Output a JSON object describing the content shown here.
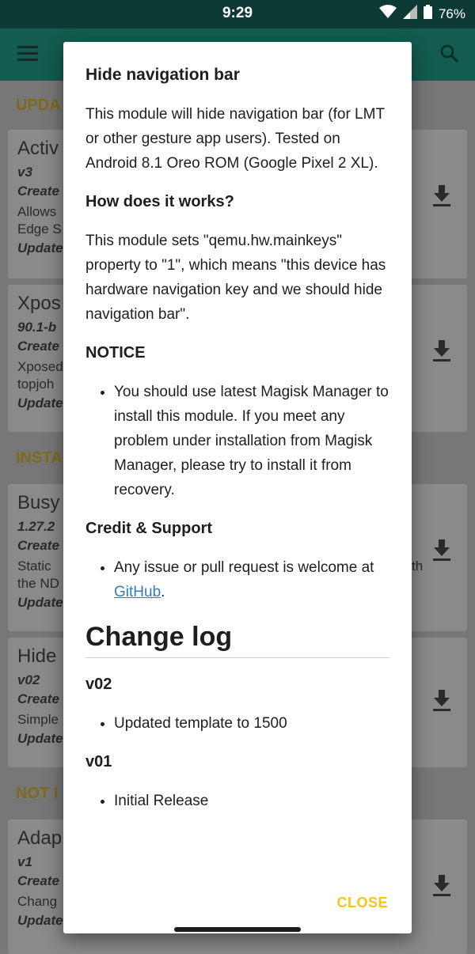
{
  "statusbar": {
    "time": "9:29",
    "battery": "76%"
  },
  "background": {
    "sections": [
      "UPDA",
      "INSTA",
      "NOT I"
    ],
    "cards": [
      {
        "name": "Activ",
        "version": "v3",
        "line1": "Create",
        "line2": "Allows",
        "line3": "Edge S",
        "line4": "Update"
      },
      {
        "name": "Xpos",
        "version": "90.1-b",
        "line1": "Create",
        "line2": "Xposed",
        "line3": "topjoh",
        "line4": "Update"
      },
      {
        "name": "Busy",
        "version": "1.27.2",
        "line1": "Create",
        "line2": "Static",
        "line3": "the ND",
        "line4": "Update",
        "extra": "th"
      },
      {
        "name": "Hide",
        "version": "v02",
        "line1": "Create",
        "line2": "Simple",
        "line3": "",
        "line4": "Update"
      },
      {
        "name": "Adap",
        "version": "v1",
        "line1": "Create",
        "line2": "Chang",
        "line3": "",
        "line4": "Update"
      }
    ]
  },
  "dialog": {
    "title": "Hide navigation bar",
    "intro": "This module will hide navigation bar (for LMT or other gesture app users). Tested on Android 8.1 Oreo ROM (Google Pixel 2 XL).",
    "how_heading": "How does it works?",
    "how_text": "This module sets \"qemu.hw.mainkeys\" property to \"1\", which means \"this device has hardware navigation key and we should hide navigation bar\".",
    "notice_heading": "NOTICE",
    "notice_item": "You should use latest Magisk Manager to install this module. If you meet any problem under installation from Magisk Manager, please try to install it from recovery.",
    "credit_heading": "Credit & Support",
    "credit_item_prefix": "Any issue or pull request is welcome at ",
    "credit_link": "GitHub",
    "credit_item_suffix": ".",
    "changelog_heading": "Change log",
    "v02_heading": "v02",
    "v02_item": "Updated template to 1500",
    "v01_heading": "v01",
    "v01_item": "Initial Release",
    "close_label": "CLOSE"
  }
}
